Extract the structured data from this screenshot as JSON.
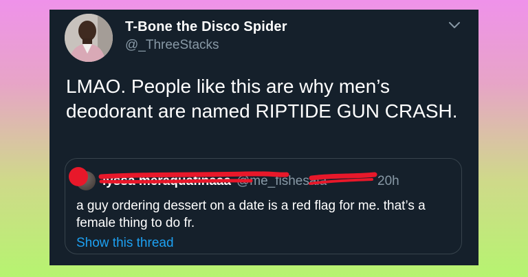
{
  "tweet": {
    "author_name": "T-Bone the Disco Spider",
    "author_handle": "@_ThreeStacks",
    "text": "LMAO. People like this are why men’s deodorant are named RIPTIDE GUN CRASH."
  },
  "quoted_tweet": {
    "author_name": "lyssa meraquafinaaa",
    "author_handle": "@me_fishesaia",
    "time": "20h",
    "text": "a guy ordering dessert on a date is a red flag for me. that’s a female thing to do fr.",
    "show_thread_label": "Show this thread"
  },
  "icons": {
    "menu": "chevron-down-icon"
  },
  "colors": {
    "card_background": "#15202b",
    "link": "#1da1f2",
    "secondary_text": "#8899a6",
    "redaction": "#e8182a"
  }
}
